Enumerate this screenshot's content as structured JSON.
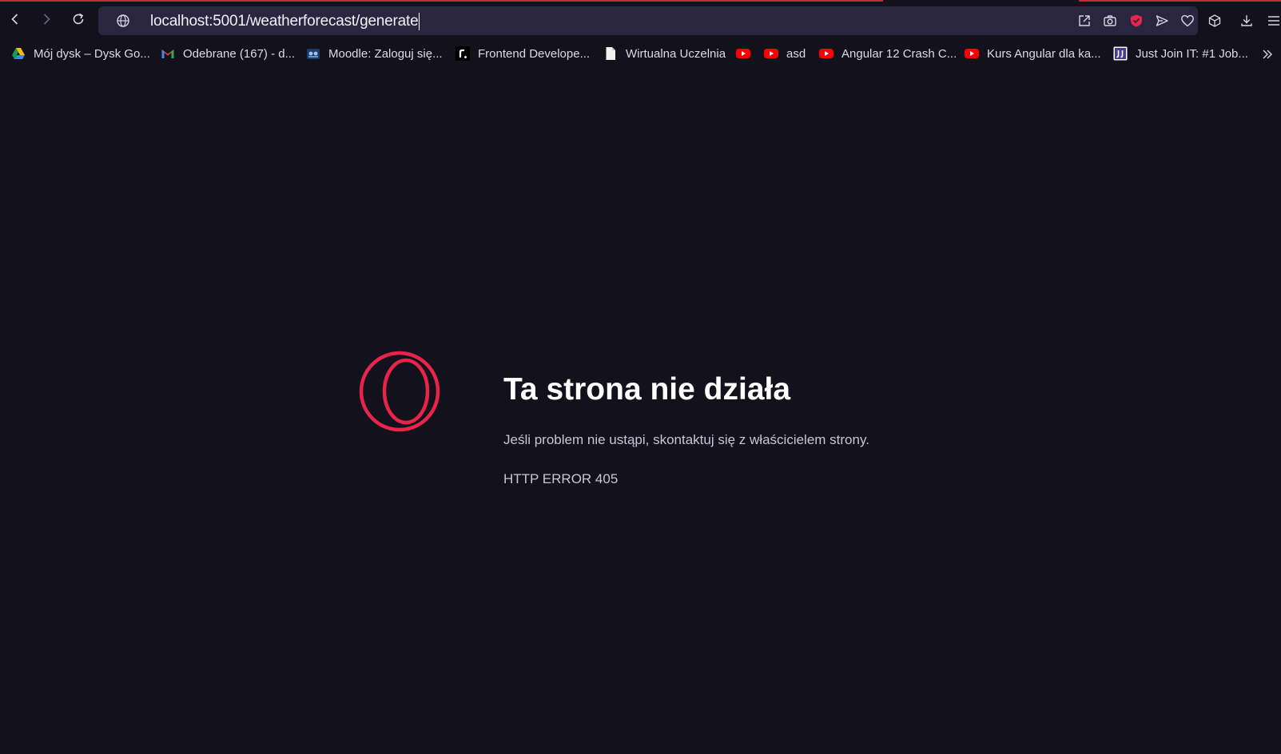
{
  "browser": {
    "url": "localhost:5001/weatherforecast/generate",
    "accent_color": "#e8244a",
    "icons": {
      "back": "chevron-left-icon",
      "forward": "chevron-right-icon",
      "reload": "reload-icon",
      "site_info": "globe-icon",
      "share": "share-icon",
      "snapshot": "camera-icon",
      "adblock": "shield-icon",
      "send": "send-icon",
      "bookmark": "heart-icon",
      "extensions": "cube-icon",
      "downloads": "download-icon",
      "easy_setup": "menu-icon"
    }
  },
  "bookmarks": [
    {
      "label": "Mój dysk – Dysk Go...",
      "icon": "google-drive-icon"
    },
    {
      "label": "Odebrane (167) - d...",
      "icon": "gmail-icon"
    },
    {
      "label": "Moodle: Zaloguj się...",
      "icon": "moodle-icon"
    },
    {
      "label": "Frontend Develope...",
      "icon": "frontend-icon"
    },
    {
      "label": "Wirtualna Uczelnia",
      "icon": "document-icon"
    },
    {
      "label": "",
      "icon": "youtube-icon"
    },
    {
      "label": "asd",
      "icon": "youtube-icon"
    },
    {
      "label": "Angular 12 Crash C...",
      "icon": "youtube-icon"
    },
    {
      "label": "Kurs Angular dla ka...",
      "icon": "youtube-icon"
    },
    {
      "label": "Just Join IT: #1 Job...",
      "icon": "justjoinit-icon"
    }
  ],
  "error": {
    "title": "Ta strona nie działa",
    "message": "Jeśli problem nie ustąpi, skontaktuj się z właścicielem strony.",
    "code": "HTTP ERROR 405",
    "logo": "opera-gx-logo"
  }
}
